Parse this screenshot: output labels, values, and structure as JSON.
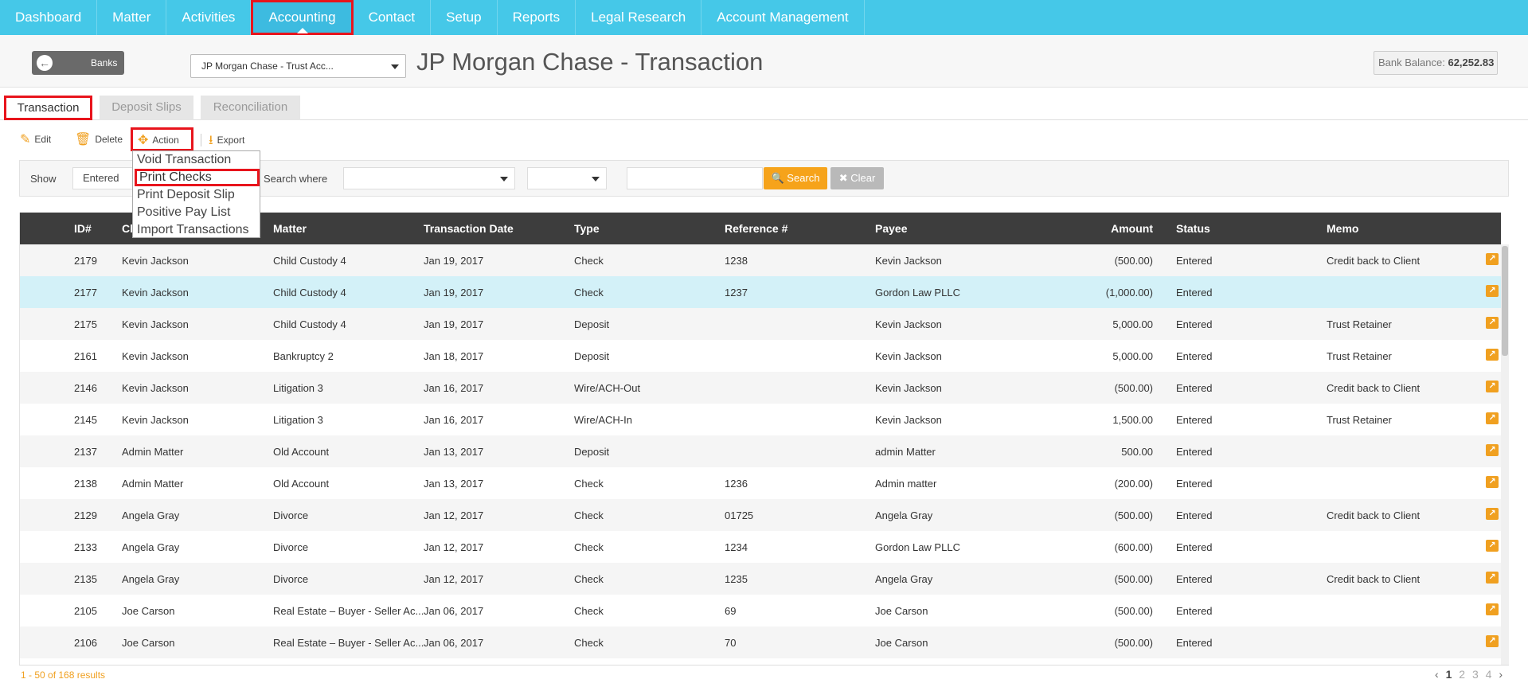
{
  "nav": {
    "items": [
      {
        "label": "Dashboard"
      },
      {
        "label": "Matter"
      },
      {
        "label": "Activities"
      },
      {
        "label": "Accounting"
      },
      {
        "label": "Contact"
      },
      {
        "label": "Setup"
      },
      {
        "label": "Reports"
      },
      {
        "label": "Legal Research"
      },
      {
        "label": "Account Management"
      }
    ],
    "active": "Accounting"
  },
  "header": {
    "back_label": "Banks",
    "bank_select_value": "JP Morgan Chase - Trust Acc...",
    "title": "JP Morgan Chase - Transaction",
    "balance_label": "Bank Balance:",
    "balance_value": "62,252.83"
  },
  "tabs": [
    {
      "label": "Transaction"
    },
    {
      "label": "Deposit Slips"
    },
    {
      "label": "Reconciliation"
    }
  ],
  "toolbar": {
    "edit": "Edit",
    "delete": "Delete",
    "action": "Action",
    "export": "Export"
  },
  "action_menu": {
    "items": [
      {
        "label": "Void Transaction"
      },
      {
        "label": "Print Checks"
      },
      {
        "label": "Print Deposit Slip"
      },
      {
        "label": "Positive Pay List"
      },
      {
        "label": "Import Transactions"
      }
    ],
    "highlighted": "Print Checks"
  },
  "filter": {
    "show_label": "Show",
    "show_value": "Entered",
    "search_where_label": "Search where",
    "search_button": "Search",
    "clear_button": "Clear"
  },
  "table": {
    "columns": {
      "id": "ID#",
      "client": "Cl",
      "matter": "Matter",
      "date": "Transaction Date",
      "type": "Type",
      "ref": "Reference #",
      "payee": "Payee",
      "amount": "Amount",
      "status": "Status",
      "memo": "Memo"
    },
    "rows": [
      {
        "id": "2179",
        "client": "Kevin Jackson",
        "matter": "Child Custody 4",
        "date": "Jan 19, 2017",
        "type": "Check",
        "ref": "1238",
        "payee": "Kevin Jackson",
        "amount": "(500.00)",
        "status": "Entered",
        "memo": "Credit back to Client"
      },
      {
        "id": "2177",
        "client": "Kevin Jackson",
        "matter": "Child Custody 4",
        "date": "Jan 19, 2017",
        "type": "Check",
        "ref": "1237",
        "payee": "Gordon Law PLLC",
        "amount": "(1,000.00)",
        "status": "Entered",
        "memo": ""
      },
      {
        "id": "2175",
        "client": "Kevin Jackson",
        "matter": "Child Custody 4",
        "date": "Jan 19, 2017",
        "type": "Deposit",
        "ref": "",
        "payee": "Kevin Jackson",
        "amount": "5,000.00",
        "status": "Entered",
        "memo": "Trust Retainer"
      },
      {
        "id": "2161",
        "client": "Kevin Jackson",
        "matter": "Bankruptcy 2",
        "date": "Jan 18, 2017",
        "type": "Deposit",
        "ref": "",
        "payee": "Kevin Jackson",
        "amount": "5,000.00",
        "status": "Entered",
        "memo": "Trust Retainer"
      },
      {
        "id": "2146",
        "client": "Kevin Jackson",
        "matter": "Litigation 3",
        "date": "Jan 16, 2017",
        "type": "Wire/ACH-Out",
        "ref": "",
        "payee": "Kevin Jackson",
        "amount": "(500.00)",
        "status": "Entered",
        "memo": "Credit back to Client"
      },
      {
        "id": "2145",
        "client": "Kevin Jackson",
        "matter": "Litigation 3",
        "date": "Jan 16, 2017",
        "type": "Wire/ACH-In",
        "ref": "",
        "payee": "Kevin Jackson",
        "amount": "1,500.00",
        "status": "Entered",
        "memo": "Trust Retainer"
      },
      {
        "id": "2137",
        "client": "Admin Matter",
        "matter": "Old Account",
        "date": "Jan 13, 2017",
        "type": "Deposit",
        "ref": "",
        "payee": "admin Matter",
        "amount": "500.00",
        "status": "Entered",
        "memo": ""
      },
      {
        "id": "2138",
        "client": "Admin Matter",
        "matter": "Old Account",
        "date": "Jan 13, 2017",
        "type": "Check",
        "ref": "1236",
        "payee": "Admin matter",
        "amount": "(200.00)",
        "status": "Entered",
        "memo": ""
      },
      {
        "id": "2129",
        "client": "Angela Gray",
        "matter": "Divorce",
        "date": "Jan 12, 2017",
        "type": "Check",
        "ref": "01725",
        "payee": "Angela Gray",
        "amount": "(500.00)",
        "status": "Entered",
        "memo": "Credit back to Client"
      },
      {
        "id": "2133",
        "client": "Angela Gray",
        "matter": "Divorce",
        "date": "Jan 12, 2017",
        "type": "Check",
        "ref": "1234",
        "payee": "Gordon Law PLLC",
        "amount": "(600.00)",
        "status": "Entered",
        "memo": ""
      },
      {
        "id": "2135",
        "client": "Angela Gray",
        "matter": "Divorce",
        "date": "Jan 12, 2017",
        "type": "Check",
        "ref": "1235",
        "payee": "Angela Gray",
        "amount": "(500.00)",
        "status": "Entered",
        "memo": "Credit back to Client"
      },
      {
        "id": "2105",
        "client": "Joe Carson",
        "matter": "Real Estate – Buyer - Seller Ac...",
        "date": "Jan 06, 2017",
        "type": "Check",
        "ref": "69",
        "payee": "Joe Carson",
        "amount": "(500.00)",
        "status": "Entered",
        "memo": ""
      },
      {
        "id": "2106",
        "client": "Joe Carson",
        "matter": "Real Estate – Buyer - Seller Ac...",
        "date": "Jan 06, 2017",
        "type": "Check",
        "ref": "70",
        "payee": "Joe Carson",
        "amount": "(500.00)",
        "status": "Entered",
        "memo": ""
      }
    ],
    "selected_row_id": "2177"
  },
  "footer": {
    "results": "1 - 50 of 168 results",
    "pages": [
      "1",
      "2",
      "3",
      "4"
    ],
    "current_page": "1",
    "prev": "‹",
    "next": "›"
  },
  "colors": {
    "nav_bg": "#45c8e8",
    "accent_orange": "#f6a31a",
    "highlight_red": "#e8141c",
    "table_header": "#3d3d3d",
    "selected_row": "#d3f1f8"
  },
  "icons": {
    "back": "arrow-left-circle-icon",
    "edit": "pencil-square-icon",
    "delete": "trash-icon",
    "action": "move-arrows-icon",
    "export": "download-icon",
    "search": "magnifier-icon",
    "clear": "x-icon",
    "row_edit": "external-link-icon"
  }
}
